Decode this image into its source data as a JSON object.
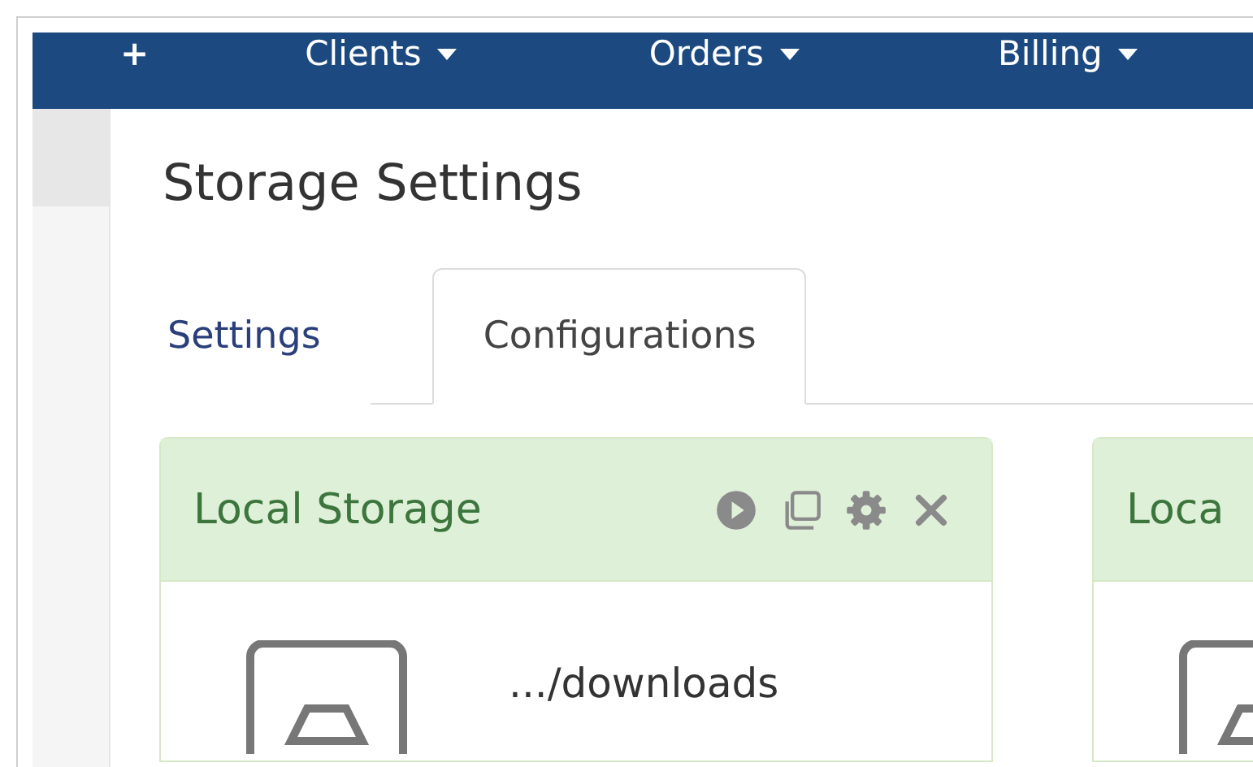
{
  "nav": {
    "items": [
      {
        "kind": "add",
        "label": "+"
      },
      {
        "kind": "menu",
        "label": "Clients"
      },
      {
        "kind": "menu",
        "label": "Orders"
      },
      {
        "kind": "menu",
        "label": "Billing"
      }
    ]
  },
  "page_title": "Storage Settings",
  "tabs": [
    {
      "label": "Settings",
      "selected": false
    },
    {
      "label": "Configurations",
      "selected": true
    }
  ],
  "cards": [
    {
      "title": "Local Storage",
      "show_actions": true,
      "path": ".../downloads"
    },
    {
      "title": "Loca",
      "show_actions": false
    }
  ]
}
